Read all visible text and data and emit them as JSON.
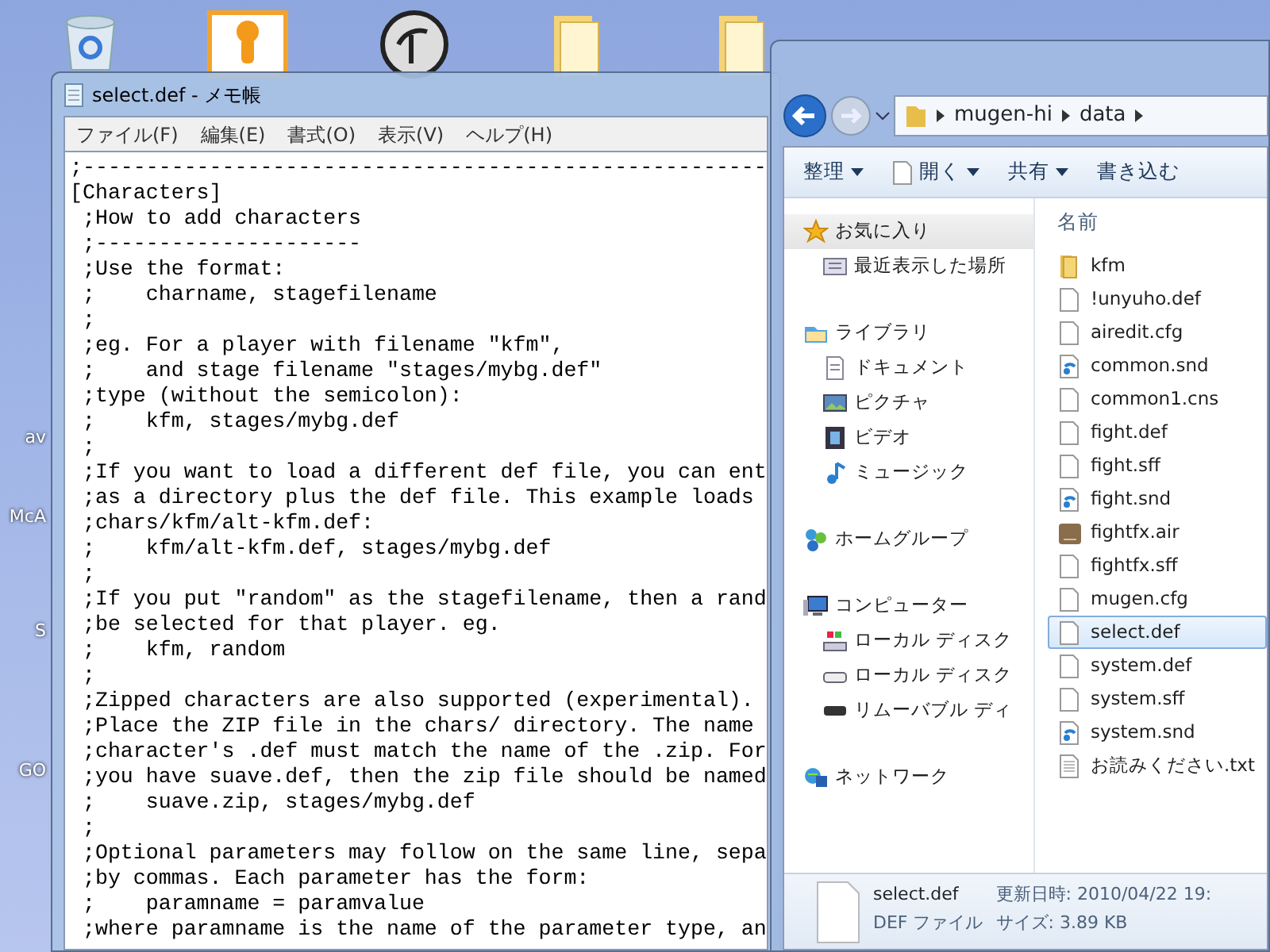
{
  "desktop": {
    "labels": [
      "av",
      "McA",
      "S",
      "GO"
    ]
  },
  "notepad": {
    "title": "select.def - メモ帳",
    "menu": [
      "ファイル(F)",
      "編集(E)",
      "書式(O)",
      "表示(V)",
      "ヘルプ(H)"
    ],
    "lines": [
      ";------------------------------------------------------",
      "[Characters]",
      " ;How to add characters",
      " ;---------------------",
      " ;Use the format:",
      " ;    charname, stagefilename",
      " ;",
      " ;eg. For a player with filename \"kfm\",",
      " ;    and stage filename \"stages/mybg.def\"",
      " ;type (without the semicolon):",
      " ;    kfm, stages/mybg.def",
      " ;",
      " ;If you want to load a different def file, you can ent",
      " ;as a directory plus the def file. This example loads",
      " ;chars/kfm/alt-kfm.def:",
      " ;    kfm/alt-kfm.def, stages/mybg.def",
      " ;",
      " ;If you put \"random\" as the stagefilename, then a rand",
      " ;be selected for that player. eg.",
      " ;    kfm, random",
      " ;",
      " ;Zipped characters are also supported (experimental).",
      " ;Place the ZIP file in the chars/ directory. The name",
      " ;character's .def must match the name of the .zip. For",
      " ;you have suave.def, then the zip file should be named",
      " ;    suave.zip, stages/mybg.def",
      " ;",
      " ;Optional parameters may follow on the same line, sepa",
      " ;by commas. Each parameter has the form:",
      " ;    paramname = paramvalue",
      " ;where paramname is the name of the parameter type, an"
    ]
  },
  "explorer": {
    "breadcrumb": [
      "mugen-hi",
      "data"
    ],
    "toolbar": [
      {
        "label": "整理",
        "kind": "menu"
      },
      {
        "label": "開く",
        "kind": "open"
      },
      {
        "label": "共有",
        "kind": "menu"
      },
      {
        "label": "書き込む",
        "kind": "plain"
      }
    ],
    "nav": [
      {
        "label": "お気に入り",
        "kind": "star",
        "selected": true,
        "children": [
          {
            "label": "最近表示した場所",
            "kind": "recent",
            "selected": false
          }
        ]
      },
      {
        "label": "ライブラリ",
        "kind": "library",
        "selected": false,
        "children": [
          {
            "label": "ドキュメント",
            "kind": "document",
            "selected": false
          },
          {
            "label": "ピクチャ",
            "kind": "picture",
            "selected": false
          },
          {
            "label": "ビデオ",
            "kind": "video",
            "selected": false
          },
          {
            "label": "ミュージック",
            "kind": "music",
            "selected": false
          }
        ]
      },
      {
        "label": "ホームグループ",
        "kind": "homegroup",
        "selected": false
      },
      {
        "label": "コンピューター",
        "kind": "computer",
        "selected": false,
        "children": [
          {
            "label": "ローカル ディスク",
            "kind": "windisk",
            "selected": false
          },
          {
            "label": "ローカル ディスク",
            "kind": "disk",
            "selected": false
          },
          {
            "label": "リムーバブル ディ",
            "kind": "removable",
            "selected": false
          }
        ]
      },
      {
        "label": "ネットワーク",
        "kind": "network",
        "selected": false
      }
    ],
    "column_header": "名前",
    "files": [
      {
        "name": "kfm",
        "kind": "folder",
        "selected": false
      },
      {
        "name": "!unyuho.def",
        "kind": "file",
        "selected": false
      },
      {
        "name": "airedit.cfg",
        "kind": "file",
        "selected": false
      },
      {
        "name": "common.snd",
        "kind": "sound",
        "selected": false
      },
      {
        "name": "common1.cns",
        "kind": "file",
        "selected": false
      },
      {
        "name": "fight.def",
        "kind": "file",
        "selected": false
      },
      {
        "name": "fight.sff",
        "kind": "file",
        "selected": false
      },
      {
        "name": "fight.snd",
        "kind": "sound",
        "selected": false
      },
      {
        "name": "fightfx.air",
        "kind": "air",
        "selected": false
      },
      {
        "name": "fightfx.sff",
        "kind": "file",
        "selected": false
      },
      {
        "name": "mugen.cfg",
        "kind": "file",
        "selected": false
      },
      {
        "name": "select.def",
        "kind": "file",
        "selected": true
      },
      {
        "name": "system.def",
        "kind": "file",
        "selected": false
      },
      {
        "name": "system.sff",
        "kind": "file",
        "selected": false
      },
      {
        "name": "system.snd",
        "kind": "sound",
        "selected": false
      },
      {
        "name": "お読みください.txt",
        "kind": "text",
        "selected": false
      }
    ],
    "details": {
      "name": "select.def",
      "modified": "更新日時: 2010/04/22 19:",
      "type": "DEF ファイル",
      "size": "サイズ: 3.89 KB"
    }
  }
}
